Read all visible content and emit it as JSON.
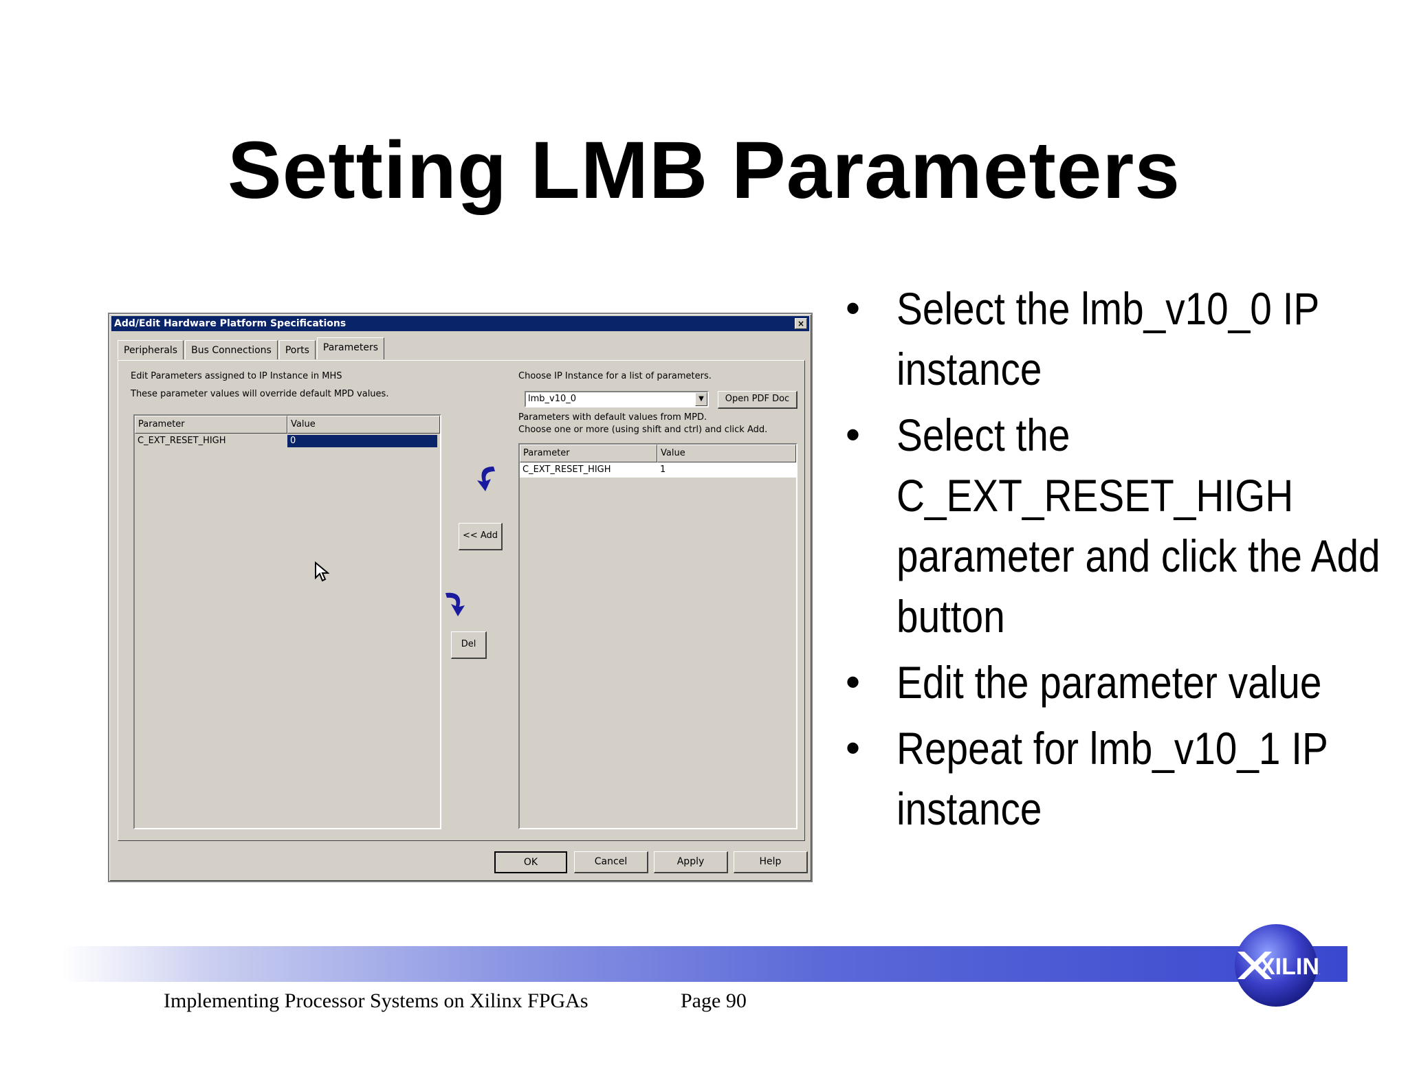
{
  "slide": {
    "title": "Setting LMB Parameters",
    "bullets": [
      "Select the lmb_v10_0 IP instance",
      "Select the C_EXT_RESET_HIGH parameter and click the Add button",
      "Edit the parameter value",
      "Repeat for lmb_v10_1 IP instance"
    ],
    "footer_left": "Implementing Processor Systems on Xilinx FPGAs",
    "footer_page": "Page 90",
    "logo_text": "XILINX"
  },
  "dialog": {
    "title": "Add/Edit Hardware Platform Specifications",
    "close_glyph": "×",
    "tabs": [
      "Peripherals",
      "Bus Connections",
      "Ports",
      "Parameters"
    ],
    "left": {
      "info_line1": "Edit Parameters assigned to IP Instance in MHS",
      "info_line2": "These parameter values will override default MPD values.",
      "col_parameter": "Parameter",
      "col_value": "Value",
      "rows": [
        {
          "parameter": "C_EXT_RESET_HIGH",
          "value": "0"
        }
      ]
    },
    "right": {
      "choose_label": "Choose IP Instance for a list of parameters.",
      "instance_value": "lmb_v10_0",
      "open_pdf_label": "Open PDF Doc",
      "help_line1": "Parameters with default values from MPD.",
      "help_line2": "Choose one or more (using shift and ctrl) and click Add.",
      "col_parameter": "Parameter",
      "col_value": "Value",
      "rows": [
        {
          "parameter": "C_EXT_RESET_HIGH",
          "value": "1"
        }
      ]
    },
    "add_label": "<< Add",
    "del_label": "Del",
    "ok_label": "OK",
    "cancel_label": "Cancel",
    "apply_label": "Apply",
    "help_label": "Help"
  },
  "colors": {
    "titlebar": "#0a246a",
    "dialog_face": "#d4d0c8",
    "arrow": "#1a1a9e"
  }
}
